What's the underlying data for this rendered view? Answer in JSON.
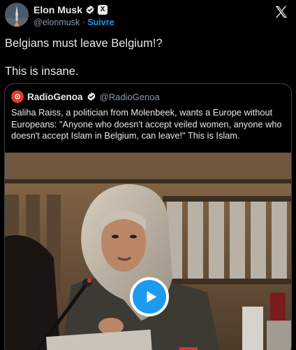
{
  "author": {
    "name": "Elon Musk",
    "handle": "@elonmusk",
    "separator": "·",
    "follow_label": "Suivre",
    "x_badge_text": "X"
  },
  "tweet": {
    "line1": "Belgians must leave Belgium!?",
    "line2": "This is insane."
  },
  "quote": {
    "name": "RadioGenoa",
    "handle": "@RadioGenoa",
    "text": "Saliha Raiss, a politician from Molenbeek, wants a Europe without Europeans: \"Anyone who doesn't accept veiled women, anyone who doesn't accept Islam in Belgium, can leave!\" This is Islam."
  },
  "icons": {
    "verified": "verified-badge-icon",
    "x_logo": "x-logo-icon",
    "play": "play-icon"
  },
  "colors": {
    "background": "#000000",
    "text": "#e7e9ea",
    "muted": "#8b98a5",
    "accent": "#1d9bf0",
    "border": "#38444d",
    "quote_avatar": "#e03a2b"
  }
}
